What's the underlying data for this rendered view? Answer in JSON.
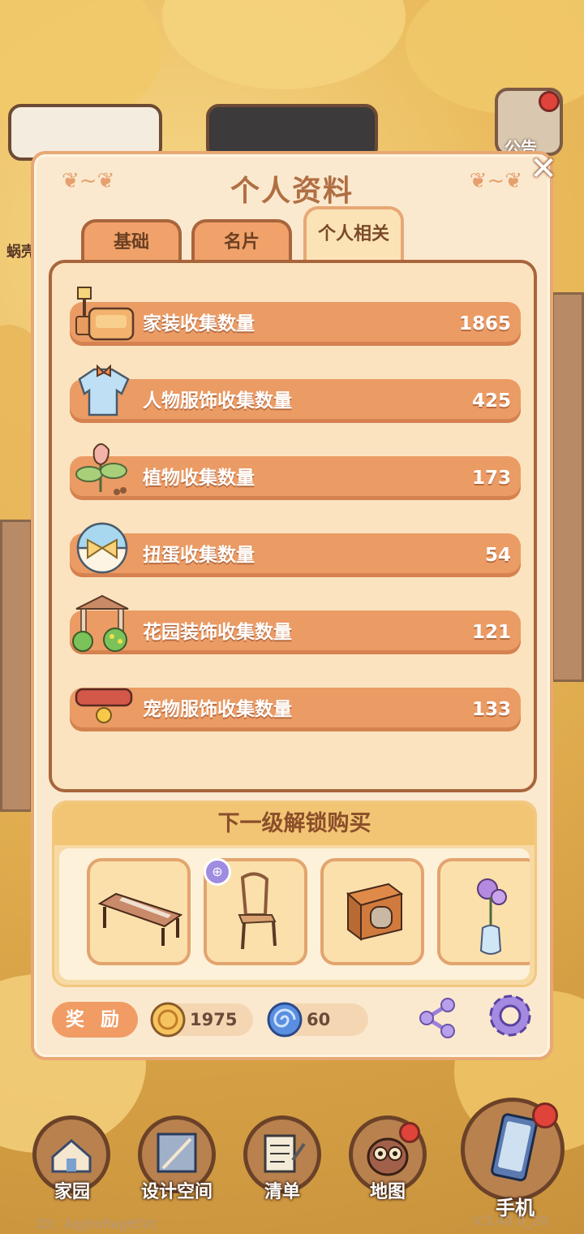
{
  "panel": {
    "title": "个人资料",
    "tabs": [
      {
        "label": "基础",
        "active": false
      },
      {
        "label": "名片",
        "active": false
      },
      {
        "label": "个人相关",
        "active": true
      }
    ]
  },
  "stats": [
    {
      "label": "家装收集数量",
      "value": "1865",
      "icon": "sofa-lamp-icon"
    },
    {
      "label": "人物服饰收集数量",
      "value": "425",
      "icon": "shirt-icon"
    },
    {
      "label": "植物收集数量",
      "value": "173",
      "icon": "tulip-sprout-icon"
    },
    {
      "label": "扭蛋收集数量",
      "value": "54",
      "icon": "capsule-icon"
    },
    {
      "label": "花园装饰收集数量",
      "value": "121",
      "icon": "pavilion-icon"
    },
    {
      "label": "宠物服饰收集数量",
      "value": "133",
      "icon": "pet-collar-icon"
    }
  ],
  "unlock": {
    "title": "下一级解锁购买",
    "items": [
      {
        "icon": "table-icon"
      },
      {
        "icon": "chair-icon",
        "badge": "bookmark-icon"
      },
      {
        "icon": "cabinet-icon"
      },
      {
        "icon": "flower-vase-icon"
      }
    ]
  },
  "rewards": {
    "label": "奖 励",
    "coin": {
      "icon": "coin-icon",
      "value": "1975"
    },
    "gem": {
      "icon": "spiral-gem-icon",
      "value": "60"
    }
  },
  "nav": [
    {
      "label": "家园",
      "icon": "house-icon"
    },
    {
      "label": "设计空间",
      "icon": "blueprint-icon"
    },
    {
      "label": "清单",
      "icon": "list-scroll-icon"
    },
    {
      "label": "地图",
      "icon": "owl-icon"
    }
  ],
  "phone": {
    "label": "手机",
    "icon": "phone-icon"
  },
  "side_label": "蜗壳",
  "notice_label": "公告",
  "footer": {
    "id": "ID：AqghoRagH5Vt",
    "version": "V.3.40.0_20"
  },
  "colors": {
    "panel_bg": "#fbe9cf",
    "stat_bar": "#eb9b64",
    "title_text": "#b06f43",
    "tab_inactive": "#f0a26a"
  }
}
